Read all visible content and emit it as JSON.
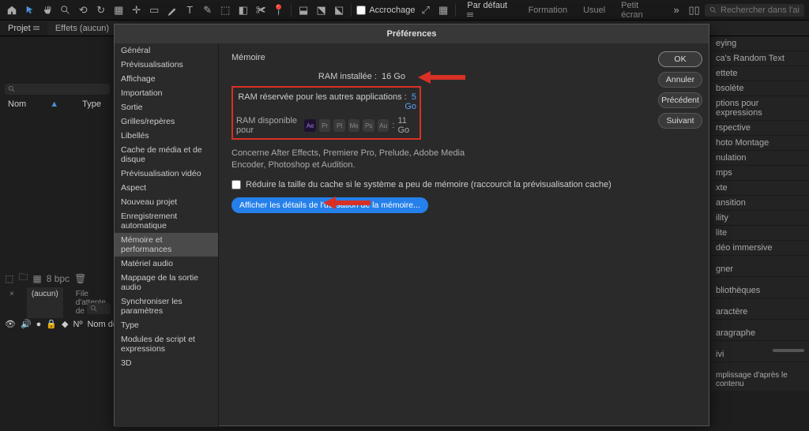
{
  "toolbar": {
    "accrochage": "Accrochage",
    "workspaces": [
      "Par défaut",
      "Formation",
      "Usuel",
      "Petit écran"
    ],
    "search_placeholder": "Rechercher dans l'aide"
  },
  "panels": {
    "projet": "Projet",
    "effets": "Effets  (aucun)"
  },
  "proj": {
    "cols": {
      "nom": "Nom",
      "type": "Type"
    },
    "bpc": "8 bpc",
    "tl_aucun": "(aucun)",
    "tl_file": "File d'attente de",
    "tl_n": "Nº",
    "tl_src": "Nom des sou"
  },
  "side": [
    "eying",
    "ca's Random Text",
    "ettete",
    "bsolète",
    "ptions pour expressions",
    "rspective",
    "hoto Montage",
    "nulation",
    "mps",
    "xte",
    "ansition",
    "ility",
    "lite",
    "déo immersive"
  ],
  "side2": [
    "gner",
    "bliothèques",
    "aractère",
    "aragraphe",
    "ivi",
    "mplissage d'après le contenu"
  ],
  "modal": {
    "title": "Préférences",
    "section": "Mémoire",
    "ram_installed_label": "RAM installée :",
    "ram_installed_value": "16 Go",
    "ram_reserved_label": "RAM réservée pour les autres applications :",
    "ram_reserved_value": "5 Go",
    "ram_available_label": "RAM disponible pour",
    "ram_available_value": "11 Go",
    "apps": [
      "Ae",
      "Pr",
      "Pl",
      "Me",
      "Ps",
      "Au"
    ],
    "note": "Concerne After Effects, Premiere Pro, Prelude, Adobe Media Encoder, Photoshop et Audition.",
    "reduce_cache": "Réduire la taille du cache si le système a peu de mémoire (raccourcit la prévisualisation cache)",
    "details_btn": "Afficher les détails de l'utilisation de la mémoire...",
    "categories": [
      "Général",
      "Prévisualisations",
      "Affichage",
      "Importation",
      "Sortie",
      "Grilles/repères",
      "Libellés",
      "Cache de média et de disque",
      "Prévisualisation vidéo",
      "Aspect",
      "Nouveau projet",
      "Enregistrement automatique",
      "Mémoire et performances",
      "Matériel audio",
      "Mappage de la sortie audio",
      "Synchroniser les paramètres",
      "Type",
      "Modules de script et expressions",
      "3D"
    ],
    "selected_index": 12,
    "buttons": {
      "ok": "OK",
      "cancel": "Annuler",
      "prev": "Précédent",
      "next": "Suivant"
    }
  }
}
